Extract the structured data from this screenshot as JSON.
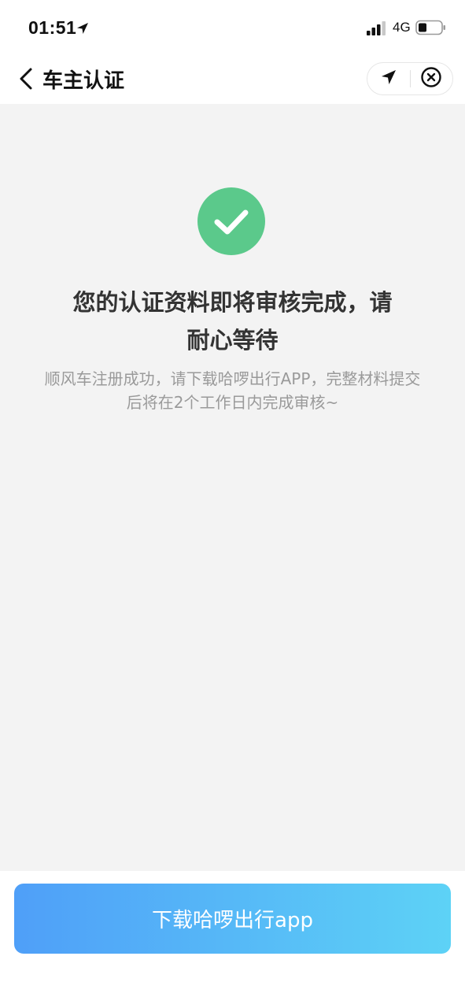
{
  "status_bar": {
    "time": "01:51",
    "network": "4G",
    "icons": [
      "location-arrow-icon",
      "signal-icon",
      "battery-icon"
    ]
  },
  "nav": {
    "back_icon": "chevron-left-icon",
    "title": "车主认证",
    "capsule_icons": [
      "location-arrow-icon",
      "close-circle-icon"
    ]
  },
  "content": {
    "status_icon": "check-circle-icon",
    "headline_line1": "您的认证资料即将审核完成，请",
    "headline_line2": "耐心等待",
    "desc_line1": "顺风车注册成功，请下载哈啰出行APP，完整材料提交",
    "desc_line2": "后将在2个工作日内完成审核~"
  },
  "bottom": {
    "download_label": "下载哈啰出行app"
  },
  "colors": {
    "success_green": "#5bc98b",
    "button_gradient_start": "#4f9ff8",
    "button_gradient_end": "#5dd2f6",
    "page_background": "#f3f3f3"
  }
}
